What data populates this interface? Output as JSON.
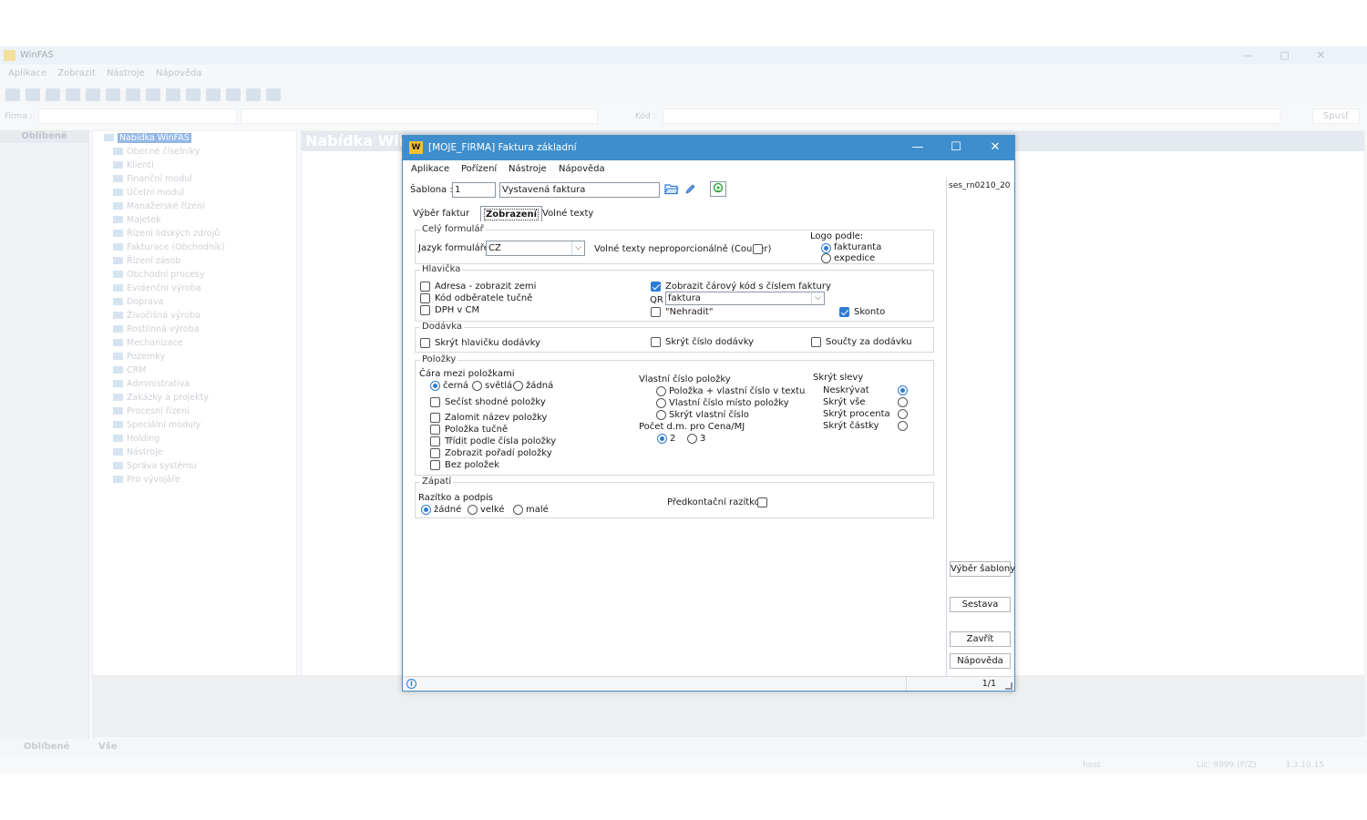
{
  "background": {
    "app_title": "WinFAS",
    "menu": [
      "Aplikace",
      "Zobrazit",
      "Nástroje",
      "Nápověda"
    ],
    "firma_label": "Firma :",
    "kod_label": "Kód :",
    "spust_label": "Spusť",
    "left_header": "Oblíbené",
    "tree_root": "Nabídka WinFAS",
    "tree_items": [
      "Obecné číselníky",
      "Klienti",
      "Finanční modul",
      "Účetní modul",
      "Manažerské řízení",
      "Majetek",
      "Řízení lidských zdrojů",
      "Fakturace (Obchodník)",
      "Řízení zásob",
      "Obchodní procesy",
      "Evidenční výroba",
      "Doprava",
      "Živočišná výroba",
      "Rostlinná výroba",
      "Mechanizace",
      "Pozemky",
      "CRM",
      "Administrativa",
      "Zakázky a projekty",
      "Procesní řízení",
      "Speciální moduly",
      "Holding",
      "Nástroje",
      "Správa systému",
      "Pro vývojáře"
    ],
    "right_header": "Nabídka WinFAS",
    "bottom_tabs": [
      "Oblíbené",
      "Vše"
    ],
    "status_user": "host",
    "status_lic": "Lic: 9999 (P/Z)",
    "status_version": "3.3.10.15"
  },
  "dialog": {
    "title": "[MOJE_FIRMA] Faktura základní",
    "app_icon_letter": "W",
    "menu": [
      "Aplikace",
      "Pořízení",
      "Nástroje",
      "Nápověda"
    ],
    "sablona_label": "Šablona :",
    "sablona_number": "1",
    "sablona_name": "Vystavená faktura",
    "tabs": [
      "Výběr faktur",
      "Zobrazení",
      "Volné texty"
    ],
    "active_tab": "Zobrazení",
    "cely_formular": {
      "label": "Celý formulář",
      "jazyk_label": "Jazyk formuláře",
      "jazyk_value": "CZ",
      "volne_texty_label": "Volné texty neproporcionálně (Courier)",
      "logo_label": "Logo podle:",
      "logo_options": [
        "fakturanta",
        "expedice"
      ]
    },
    "hlavicka": {
      "label": "Hlavička",
      "adresa": "Adresa - zobrazit zemi",
      "kod_odberatele": "Kód odběratele tučně",
      "dph_cm": "DPH v CM",
      "carovy_kod": "Zobrazit čárový kód s číslem faktury",
      "qr_label": "QR",
      "qr_value": "faktura",
      "nehradit": "\"Nehradit\"",
      "skonto": "Skonto"
    },
    "dodavka": {
      "label": "Dodávka",
      "skryt_hlavicku": "Skrýt hlavičku dodávky",
      "skryt_cislo": "Skrýt číslo dodávky",
      "soucty": "Součty za dodávku"
    },
    "polozky": {
      "label": "Položky",
      "cara_label": "Čára mezi položkami",
      "cara_options": [
        "černá",
        "světlá",
        "žádná"
      ],
      "secist": "Sečíst shodné položky",
      "zalomit": "Zalomit název položky",
      "tucne": "Položka tučně",
      "tridit": "Třídit podle čísla položky",
      "poradi": "Zobrazit pořadí položky",
      "bez": "Bez položek",
      "vlastni_label": "Vlastní číslo položky",
      "vlastni_options": [
        "Položka + vlastní číslo v textu",
        "Vlastní číslo místo položky",
        "Skrýt vlastní číslo"
      ],
      "pocet_label": "Počet d.m. pro Cena/MJ",
      "pocet_options": [
        "2",
        "3"
      ],
      "slevy_label": "Skrýt slevy",
      "slevy_options": [
        "Neskrývat",
        "Skrýt vše",
        "Skrýt procenta",
        "Skrýt částky"
      ]
    },
    "zapati": {
      "label": "Zápatí",
      "razitko_label": "Razítko a podpis",
      "razitko_options": [
        "žádné",
        "velké",
        "malé"
      ],
      "predkontacni": "Předkontační razítko"
    },
    "right_panel": {
      "report_name": "ses_rn0210_20",
      "vyber_sablony": "Výběr šablony",
      "sestava": "Sestava",
      "zavrit": "Zavřít",
      "napoveda": "Nápověda"
    },
    "status_page": "1/1"
  }
}
